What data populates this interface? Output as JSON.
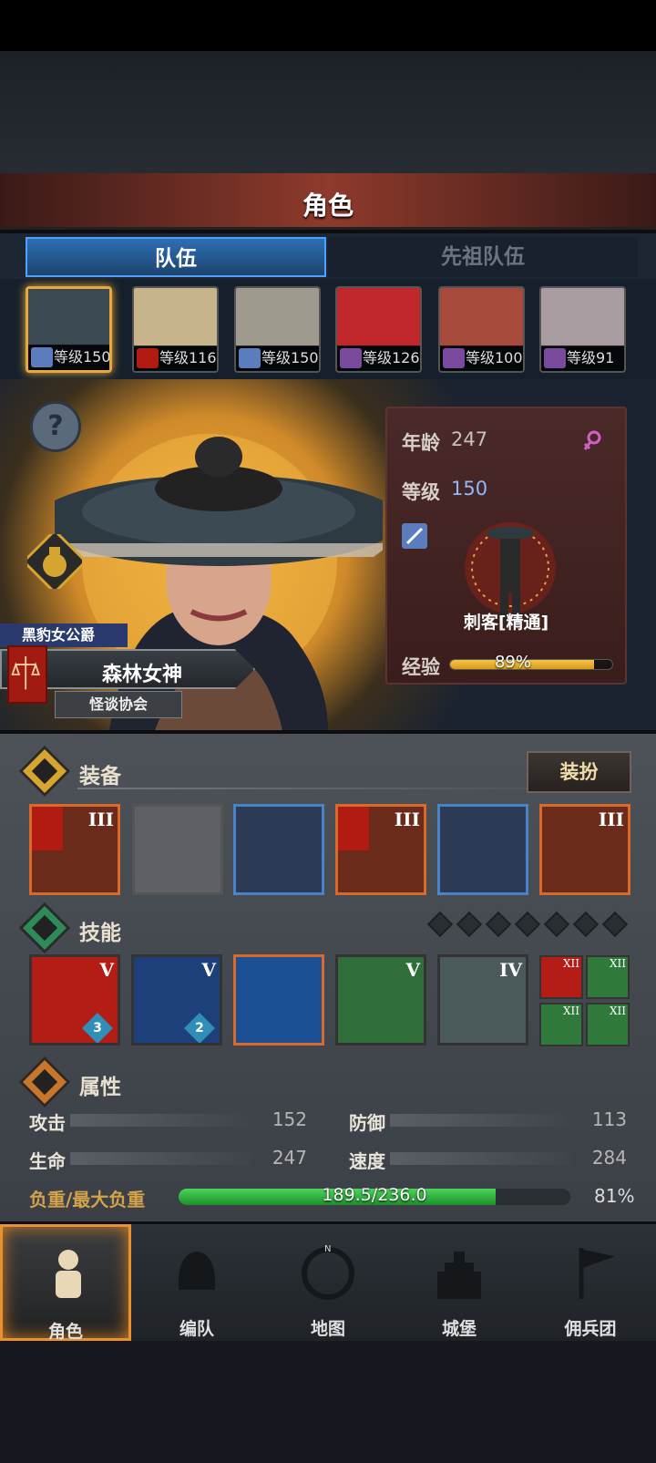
{
  "header": {
    "title": "角色"
  },
  "tabs": [
    {
      "label": "队伍"
    },
    {
      "label": "先祖队伍"
    }
  ],
  "roster": [
    {
      "level_label": "等级150",
      "face_color": "#3b4a52",
      "class_color": "#5b7dbd"
    },
    {
      "level_label": "等级116",
      "face_color": "#c7b48a",
      "class_color": "#b11b12"
    },
    {
      "level_label": "等级150",
      "face_color": "#9e9a8e",
      "class_color": "#5b7dbd"
    },
    {
      "level_label": "等级126",
      "face_color": "#c0272a",
      "class_color": "#7a4a9e"
    },
    {
      "level_label": "等级100",
      "face_color": "#a64a3c",
      "class_color": "#7a4a9e"
    },
    {
      "level_label": "等级91",
      "face_color": "#a89ca0",
      "class_color": "#7a4a9e"
    }
  ],
  "hero": {
    "title_badge": "黑豹女公爵",
    "name": "森林女神",
    "guild": "怪谈协会",
    "age_label": "年龄",
    "age": "247",
    "level_label": "等级",
    "level": "150",
    "class_name": "刺客[精通]",
    "exp_label": "经验",
    "exp_percent": 89,
    "exp_text": "89%"
  },
  "equipment": {
    "title": "装备",
    "dress_button": "装扮",
    "slots": [
      {
        "tier": "III",
        "style": "orange"
      },
      {
        "tier": "",
        "style": "empty"
      },
      {
        "tier": "",
        "style": "blue"
      },
      {
        "tier": "III",
        "style": "orange"
      },
      {
        "tier": "",
        "style": "blue"
      },
      {
        "tier": "III",
        "style": "orange"
      }
    ]
  },
  "skills": {
    "title": "技能",
    "items": [
      {
        "tier": "V",
        "badge": "3",
        "color": "#b41d16"
      },
      {
        "tier": "V",
        "badge": "2",
        "color": "#1d3f7a"
      },
      {
        "tier": "",
        "badge": "",
        "color": "#1d4f94"
      },
      {
        "tier": "V",
        "badge": "",
        "color": "#2f6e3a"
      },
      {
        "tier": "IV",
        "badge": "",
        "color": "#4a5a5a"
      }
    ],
    "mini": [
      {
        "tier": "XII",
        "color": "#b41d16"
      },
      {
        "tier": "XII",
        "color": "#2f7a3a"
      },
      {
        "tier": "XII",
        "color": "#2f7a3a"
      },
      {
        "tier": "XII",
        "color": "#2f7a3a"
      }
    ]
  },
  "attributes": {
    "title": "属性",
    "attack_label": "攻击",
    "attack": "152",
    "defense_label": "防御",
    "defense": "113",
    "hp_label": "生命",
    "hp": "247",
    "speed_label": "速度",
    "speed": "284",
    "load_label": "负重/最大负重",
    "load_text": "189.5/236.0",
    "load_percent": 81,
    "load_pct_text": "81%"
  },
  "nav": [
    {
      "label": "角色"
    },
    {
      "label": "编队"
    },
    {
      "label": "地图"
    },
    {
      "label": "城堡"
    },
    {
      "label": "佣兵团"
    }
  ]
}
